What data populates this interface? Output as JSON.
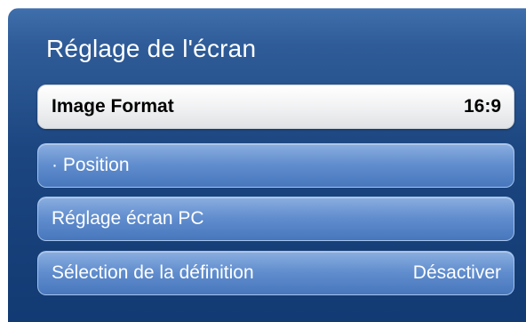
{
  "menu": {
    "title": "Réglage de l'écran",
    "items": [
      {
        "label": "Image Format",
        "value": "16:9",
        "selected": true
      },
      {
        "label": "· Position",
        "value": "",
        "selected": false
      },
      {
        "label": "Réglage écran PC",
        "value": "",
        "selected": false
      },
      {
        "label": "Sélection de la définition",
        "value": "Désactiver",
        "selected": false
      }
    ]
  },
  "colors": {
    "panel_background": "#1c4680",
    "item_background": "#5f8ccd",
    "selected_item_background": "#f1f2f3",
    "text_light": "#ffffff",
    "text_dark": "#000000"
  }
}
